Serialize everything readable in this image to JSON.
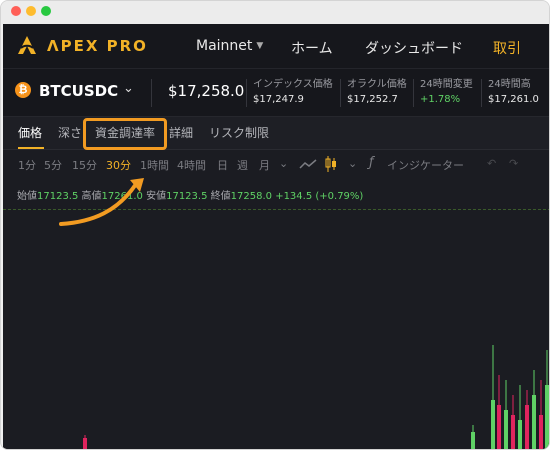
{
  "header": {
    "logo_text": "ΛPEX PRO",
    "network": "Mainnet",
    "nav": {
      "home": "ホーム",
      "dashboard": "ダッシュボード",
      "trade": "取引"
    }
  },
  "ticker": {
    "coin_letter": "₿",
    "symbol": "BTCUSDC",
    "price": "$17,258.0",
    "stats": [
      {
        "label": "インデックス価格",
        "value": "$17,247.9"
      },
      {
        "label": "オラクル価格",
        "value": "$17,252.7"
      },
      {
        "label": "24時間変更",
        "value": "+1.78%"
      },
      {
        "label": "24時間高",
        "value": "$17,261.0"
      }
    ]
  },
  "tabs": {
    "price": "価格",
    "depth": "深さ",
    "funding": "資金調達率",
    "details": "詳細",
    "risk": "リスク制限"
  },
  "toolbar": {
    "intervals": [
      "1分",
      "5分",
      "15分",
      "30分",
      "1時間",
      "4時間",
      "日",
      "週",
      "月"
    ],
    "active_interval": "30分",
    "indicators": "インジケーター"
  },
  "ohlc": {
    "open_label": "始値",
    "open": "17123.5",
    "high_label": "高値",
    "high": "17261.0",
    "low_label": "安値",
    "low": "17123.5",
    "close_label": "終値",
    "close": "17258.0",
    "change": "+134.5 (+0.79%)"
  },
  "colors": {
    "accent": "#f2b227",
    "up": "#5fd165",
    "down": "#e0245e",
    "highlight_box": "#f29b22"
  }
}
